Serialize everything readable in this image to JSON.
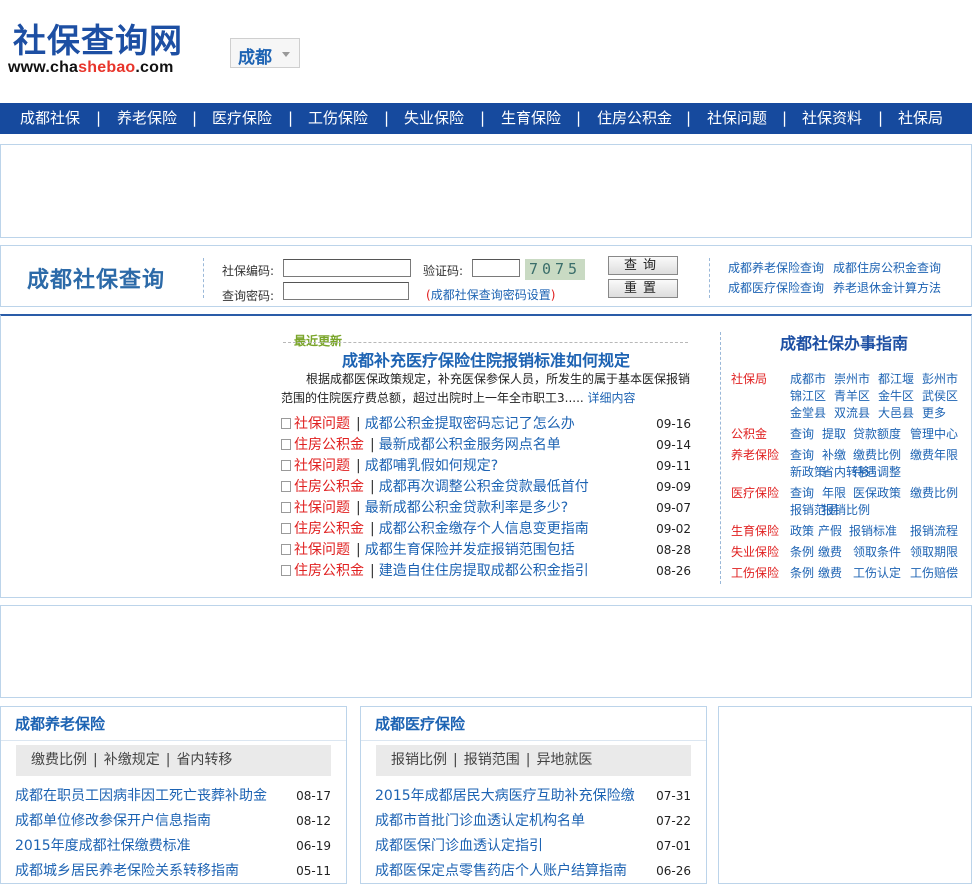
{
  "logo": {
    "title": "社保查询网",
    "url_prefix": "www.cha",
    "url_highlight": "shebao",
    "url_suffix": ".com"
  },
  "city_select": {
    "value": "成都"
  },
  "nav": [
    "成都社保",
    "养老保险",
    "医疗保险",
    "工伤保险",
    "失业保险",
    "生育保险",
    "住房公积金",
    "社保问题",
    "社保资料",
    "社保局"
  ],
  "query": {
    "title": "成都社保查询",
    "code_label": "社保编码:",
    "pwd_label": "查询密码:",
    "captcha_label": "验证码:",
    "captcha_value": "7075",
    "submit": "查询",
    "reset": "重置",
    "tip_open": "(",
    "tip_text": "成都社保查询密码设置",
    "tip_close": ")",
    "links": [
      "成都养老保险查询",
      "成都住房公积金查询",
      "成都医疗保险查询",
      "养老退休金计算方法"
    ]
  },
  "latest": {
    "tag": "最近更新",
    "headline": "成都补充医疗保险住院报销标准如何规定",
    "summary": "根据成都医保政策规定，补充医保参保人员，所发生的属于基本医保报销范围的住院医疗费总额，超过出院时上一年全市职工3.....",
    "more": "详细内容",
    "items": [
      {
        "cat": "社保问题",
        "title": "成都公积金提取密码忘记了怎么办",
        "date": "09-16"
      },
      {
        "cat": "住房公积金",
        "title": "最新成都公积金服务网点名单",
        "date": "09-14"
      },
      {
        "cat": "社保问题",
        "title": "成都哺乳假如何规定?",
        "date": "09-11"
      },
      {
        "cat": "住房公积金",
        "title": "成都再次调整公积金贷款最低首付",
        "date": "09-09"
      },
      {
        "cat": "社保问题",
        "title": "最新成都公积金贷款利率是多少?",
        "date": "09-07"
      },
      {
        "cat": "住房公积金",
        "title": "成都公积金缴存个人信息变更指南",
        "date": "09-02"
      },
      {
        "cat": "社保问题",
        "title": "成都生育保险并发症报销范围包括",
        "date": "08-28"
      },
      {
        "cat": "住房公积金",
        "title": "建造自住住房提取成都公积金指引",
        "date": "08-26"
      }
    ]
  },
  "guide": {
    "title": "成都社保办事指南",
    "groups": [
      {
        "cat": "社保局",
        "links": [
          "成都市",
          "崇州市",
          "都江堰",
          "彭州市",
          "锦江区",
          "青羊区",
          "金牛区",
          "武侯区",
          "金堂县",
          "双流县",
          "大邑县",
          "更多"
        ]
      },
      {
        "cat": "公积金",
        "links": [
          "查询",
          "提取",
          "贷款额度",
          "管理中心"
        ]
      },
      {
        "cat": "养老保险",
        "links": [
          "查询",
          "补缴",
          "缴费比例",
          "缴费年限",
          "新政策",
          "省内转移",
          "待遇调整"
        ]
      },
      {
        "cat": "医疗保险",
        "links": [
          "查询",
          "年限",
          "医保政策",
          "缴费比例",
          "报销范围",
          "报销比例"
        ]
      },
      {
        "cat": "生育保险",
        "links": [
          "政策",
          "产假",
          "报销标准",
          "报销流程"
        ]
      },
      {
        "cat": "失业保险",
        "links": [
          "条例",
          "缴费",
          "领取条件",
          "领取期限"
        ]
      },
      {
        "cat": "工伤保险",
        "links": [
          "条例",
          "缴费",
          "工伤认定",
          "工伤赔偿"
        ]
      }
    ]
  },
  "panels": [
    {
      "title": "成都养老保险",
      "tags": [
        "缴费比例",
        "补缴规定",
        "省内转移"
      ],
      "rows": [
        {
          "title": "成都在职员工因病非因工死亡丧葬补助金",
          "date": "08-17"
        },
        {
          "title": "成都单位修改参保开户信息指南",
          "date": "08-12"
        },
        {
          "title": "2015年度成都社保缴费标准",
          "date": "06-19"
        },
        {
          "title": "成都城乡居民养老保险关系转移指南",
          "date": "05-11"
        }
      ]
    },
    {
      "title": "成都医疗保险",
      "tags": [
        "报销比例",
        "报销范围",
        "异地就医"
      ],
      "rows": [
        {
          "title": "2015年成都居民大病医疗互助补充保险缴",
          "date": "07-31"
        },
        {
          "title": "成都市首批门诊血透认定机构名单",
          "date": "07-22"
        },
        {
          "title": "成都医保门诊血透认定指引",
          "date": "07-01"
        },
        {
          "title": "成都医保定点零售药店个人账户结算指南",
          "date": "06-26"
        }
      ]
    }
  ]
}
